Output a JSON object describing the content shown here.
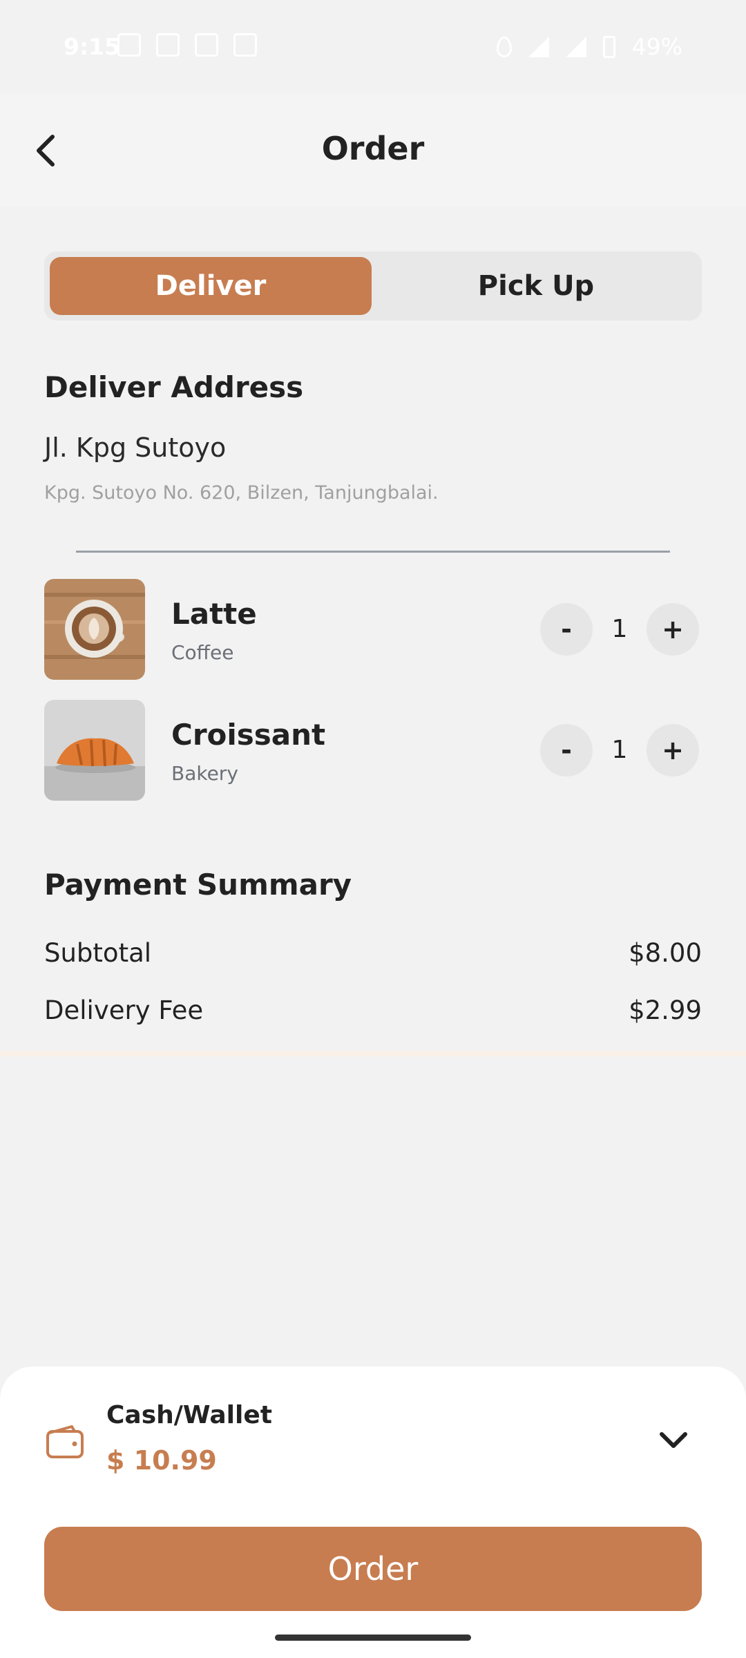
{
  "status_bar": {
    "time": "9:15",
    "battery": "49%"
  },
  "header": {
    "title": "Order"
  },
  "tabs": {
    "deliver": "Deliver",
    "pickup": "Pick Up"
  },
  "address": {
    "title": "Deliver Address",
    "line1": "Jl. Kpg Sutoyo",
    "line2": "Kpg. Sutoyo No. 620, Bilzen, Tanjungbalai."
  },
  "items": [
    {
      "name": "Latte",
      "category": "Coffee",
      "qty": "1",
      "minus": "-",
      "plus": "+"
    },
    {
      "name": "Croissant",
      "category": "Bakery",
      "qty": "1",
      "minus": "-",
      "plus": "+"
    }
  ],
  "payment": {
    "title": "Payment Summary",
    "rows": [
      {
        "label": "Subtotal",
        "value": "$8.00"
      },
      {
        "label": "Delivery Fee",
        "value": "$2.99"
      }
    ]
  },
  "checkout": {
    "method": "Cash/Wallet",
    "total": "$ 10.99",
    "button": "Order"
  },
  "colors": {
    "accent": "#c77d50",
    "background": "#f2f2f2"
  }
}
